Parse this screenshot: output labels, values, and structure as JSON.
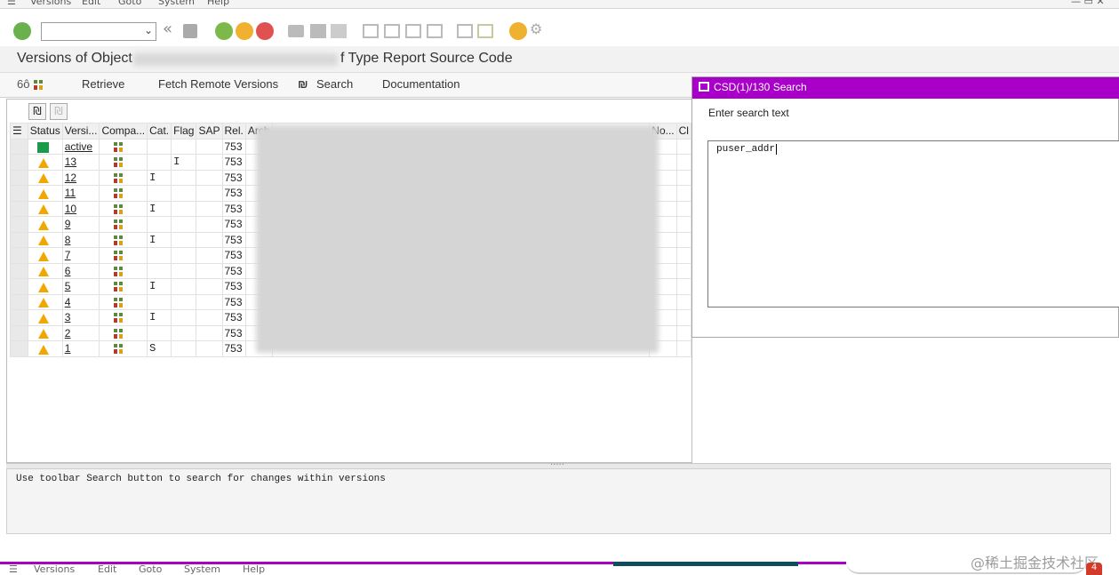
{
  "menubar": {
    "items": [
      "Versions",
      "Edit",
      "Goto",
      "System",
      "Help"
    ]
  },
  "titlebar": {
    "title_prefix": "Versions of Object",
    "title_suffix": "f Type Report Source Code"
  },
  "app_toolbar": {
    "retrieve": "Retrieve",
    "fetch_remote": "Fetch Remote Versions",
    "search": "Search",
    "documentation": "Documentation"
  },
  "grid": {
    "headers": [
      "Status",
      "Versi...",
      "Compa...",
      "Cat.",
      "Flag",
      "SAP",
      "Rel.",
      "Arch"
    ],
    "trailing_headers": [
      "No...",
      "Cl"
    ],
    "rows": [
      {
        "status": "active",
        "version": "active",
        "cat": "",
        "flag": "",
        "rel": "753"
      },
      {
        "status": "warning",
        "version": "13",
        "cat": "",
        "flag": "I",
        "rel": "753"
      },
      {
        "status": "warning",
        "version": "12",
        "cat": "I",
        "flag": "",
        "rel": "753"
      },
      {
        "status": "warning",
        "version": "11",
        "cat": "",
        "flag": "",
        "rel": "753"
      },
      {
        "status": "warning",
        "version": "10",
        "cat": "I",
        "flag": "",
        "rel": "753"
      },
      {
        "status": "warning",
        "version": "9",
        "cat": "",
        "flag": "",
        "rel": "753"
      },
      {
        "status": "warning",
        "version": "8",
        "cat": "I",
        "flag": "",
        "rel": "753"
      },
      {
        "status": "warning",
        "version": "7",
        "cat": "",
        "flag": "",
        "rel": "753"
      },
      {
        "status": "warning",
        "version": "6",
        "cat": "",
        "flag": "",
        "rel": "753"
      },
      {
        "status": "warning",
        "version": "5",
        "cat": "I",
        "flag": "",
        "rel": "753"
      },
      {
        "status": "warning",
        "version": "4",
        "cat": "",
        "flag": "",
        "rel": "753"
      },
      {
        "status": "warning",
        "version": "3",
        "cat": "I",
        "flag": "",
        "rel": "753"
      },
      {
        "status": "warning",
        "version": "2",
        "cat": "",
        "flag": "",
        "rel": "753"
      },
      {
        "status": "warning",
        "version": "1",
        "cat": "S",
        "flag": "",
        "rel": "753"
      }
    ]
  },
  "message": "Use toolbar Search button to search for changes within versions",
  "search_dialog": {
    "title": "CSD(1)/130 Search",
    "label": "Enter search text",
    "value": "puser_addr"
  },
  "bottom_menu": {
    "items": [
      "Versions",
      "Edit",
      "Goto",
      "System",
      "Help"
    ]
  },
  "watermark": "@稀土掘金技术社区",
  "badge": "4",
  "colors": {
    "dialog_header": "#a800c8",
    "active_status": "#1a9a4a",
    "warning_status": "#f0a800"
  }
}
